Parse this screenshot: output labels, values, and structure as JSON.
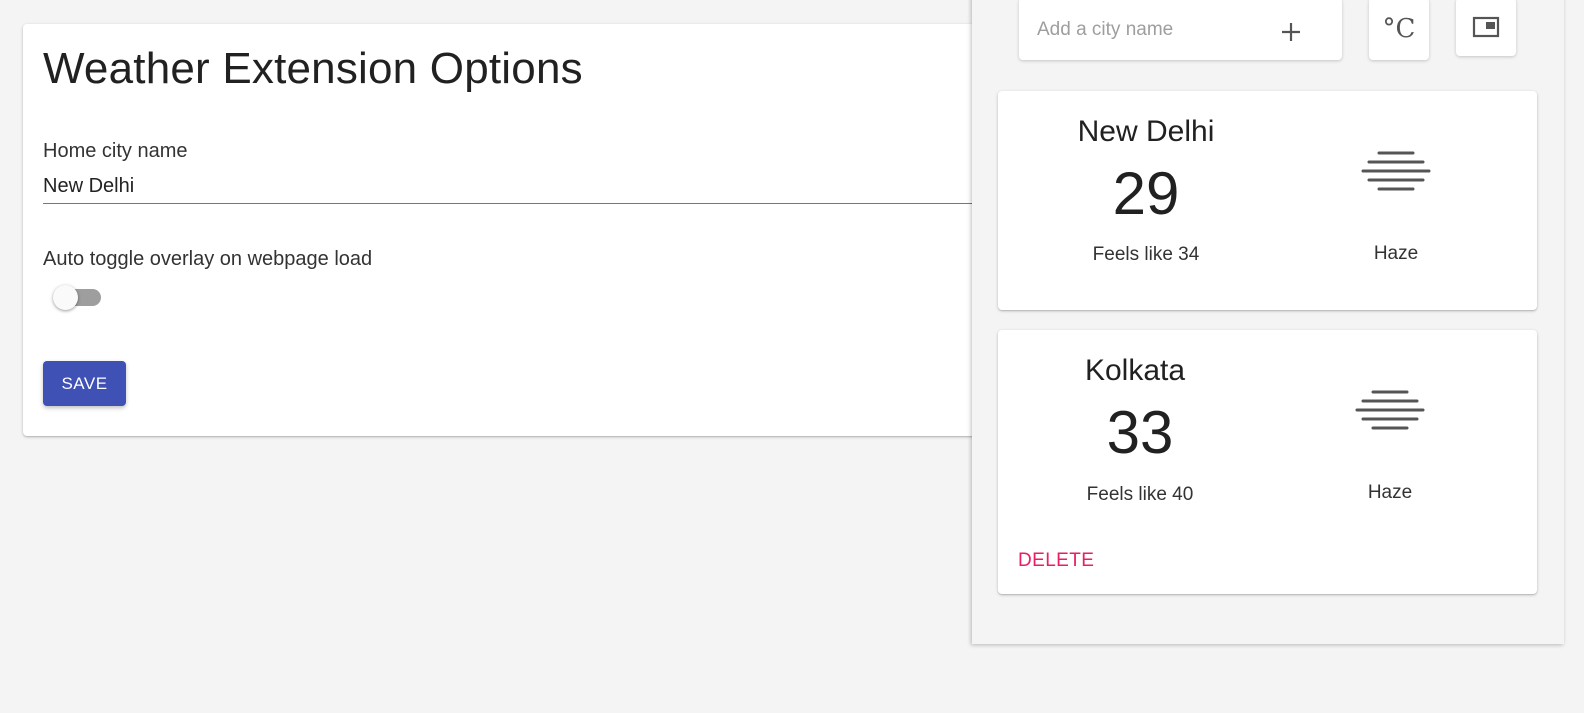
{
  "options": {
    "title": "Weather Extension Options",
    "home_city_label": "Home city name",
    "home_city_value": "New Delhi",
    "auto_toggle_label": "Auto toggle overlay on webpage load",
    "auto_toggle_on": false,
    "save_label": "SAVE"
  },
  "overlay": {
    "add_city_placeholder": "Add a city name",
    "add_icon": "plus-icon",
    "unit_label": "°C",
    "pip_icon": "picture-in-picture-icon",
    "cities": [
      {
        "name": "New Delhi",
        "temp": "29",
        "feels": "Feels like 34",
        "condition": "Haze",
        "icon": "haze-icon"
      },
      {
        "name": "Kolkata",
        "temp": "33",
        "feels": "Feels like 40",
        "condition": "Haze",
        "icon": "haze-icon",
        "delete_label": "DELETE"
      }
    ]
  },
  "colors": {
    "primary": "#3f51b5",
    "accent": "#e91e63",
    "background": "#f4f4f4"
  }
}
